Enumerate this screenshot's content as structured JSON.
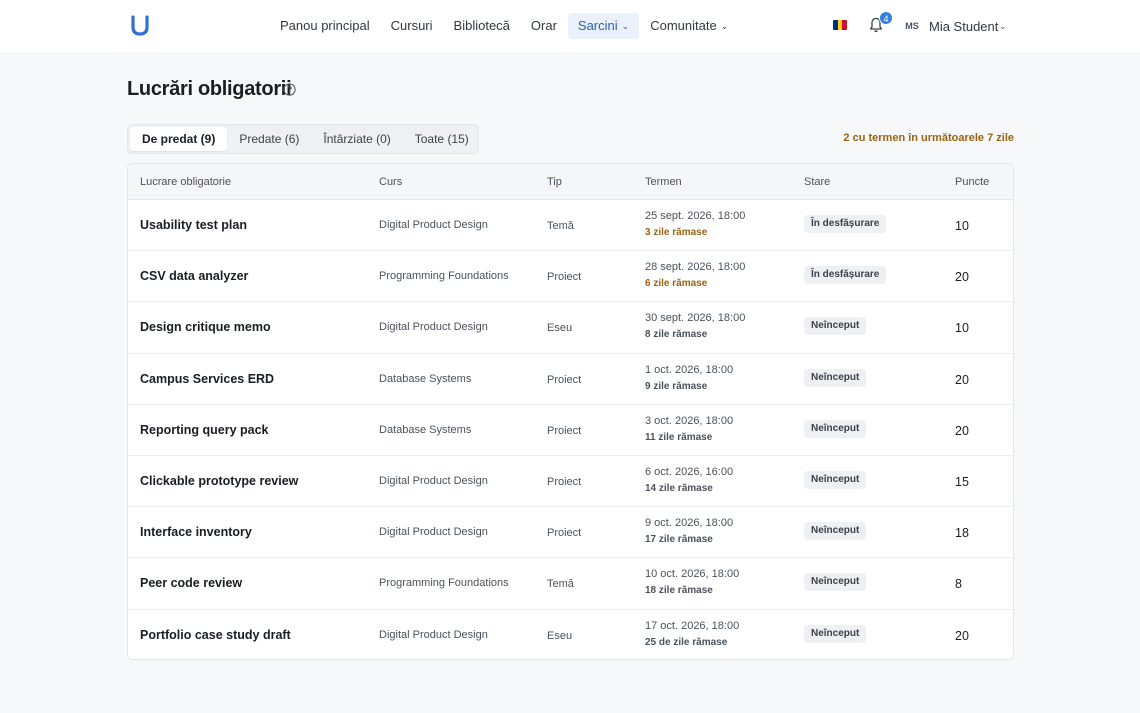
{
  "nav": {
    "items": [
      {
        "label": "Panou principal",
        "active": false,
        "dropdown": false
      },
      {
        "label": "Cursuri",
        "active": false,
        "dropdown": false
      },
      {
        "label": "Bibliotecă",
        "active": false,
        "dropdown": false
      },
      {
        "label": "Orar",
        "active": false,
        "dropdown": false
      },
      {
        "label": "Sarcini",
        "active": true,
        "dropdown": true
      },
      {
        "label": "Comunitate",
        "active": false,
        "dropdown": true
      }
    ],
    "notifications_count": "4",
    "avatar_initials": "MS",
    "user_name": "Mia Student",
    "language_flag": "romania-flag-icon"
  },
  "page": {
    "title": "Lucrări obligatorii",
    "due_note": "2 cu termen în următoarele 7 zile"
  },
  "tabs": [
    {
      "label": "De predat (9)",
      "active": true
    },
    {
      "label": "Predate (6)",
      "active": false
    },
    {
      "label": "Întârziate (0)",
      "active": false
    },
    {
      "label": "Toate (15)",
      "active": false
    }
  ],
  "table": {
    "headers": {
      "name": "Lucrare obligatorie",
      "course": "Curs",
      "type": "Tip",
      "due": "Termen",
      "status": "Stare",
      "points": "Puncte"
    },
    "rows": [
      {
        "name": "Usability test plan",
        "course": "Digital Product Design",
        "type": "Temă",
        "due": "25 sept. 2026, 18:00",
        "left": "3 zile rămase",
        "warn": true,
        "status": "În desfășurare",
        "points": "10"
      },
      {
        "name": "CSV data analyzer",
        "course": "Programming Foundations",
        "type": "Proiect",
        "due": "28 sept. 2026, 18:00",
        "left": "6 zile rămase",
        "warn": true,
        "status": "În desfășurare",
        "points": "20"
      },
      {
        "name": "Design critique memo",
        "course": "Digital Product Design",
        "type": "Eseu",
        "due": "30 sept. 2026, 18:00",
        "left": "8 zile rămase",
        "warn": false,
        "status": "Neînceput",
        "points": "10"
      },
      {
        "name": "Campus Services ERD",
        "course": "Database Systems",
        "type": "Proiect",
        "due": "1 oct. 2026, 18:00",
        "left": "9 zile rămase",
        "warn": false,
        "status": "Neînceput",
        "points": "20"
      },
      {
        "name": "Reporting query pack",
        "course": "Database Systems",
        "type": "Proiect",
        "due": "3 oct. 2026, 18:00",
        "left": "11 zile rămase",
        "warn": false,
        "status": "Neînceput",
        "points": "20"
      },
      {
        "name": "Clickable prototype review",
        "course": "Digital Product Design",
        "type": "Proiect",
        "due": "6 oct. 2026, 16:00",
        "left": "14 zile rămase",
        "warn": false,
        "status": "Neînceput",
        "points": "15"
      },
      {
        "name": "Interface inventory",
        "course": "Digital Product Design",
        "type": "Proiect",
        "due": "9 oct. 2026, 18:00",
        "left": "17 zile rămase",
        "warn": false,
        "status": "Neînceput",
        "points": "18"
      },
      {
        "name": "Peer code review",
        "course": "Programming Foundations",
        "type": "Temă",
        "due": "10 oct. 2026, 18:00",
        "left": "18 zile rămase",
        "warn": false,
        "status": "Neînceput",
        "points": "8"
      },
      {
        "name": "Portfolio case study draft",
        "course": "Digital Product Design",
        "type": "Eseu",
        "due": "17 oct. 2026, 18:00",
        "left": "25 de zile rămase",
        "warn": false,
        "status": "Neînceput",
        "points": "20"
      }
    ]
  },
  "colors": {
    "accent": "#2563b8",
    "warning_text": "#9a6410",
    "flag": [
      "#002b7f",
      "#fcd116",
      "#ce1126"
    ]
  }
}
